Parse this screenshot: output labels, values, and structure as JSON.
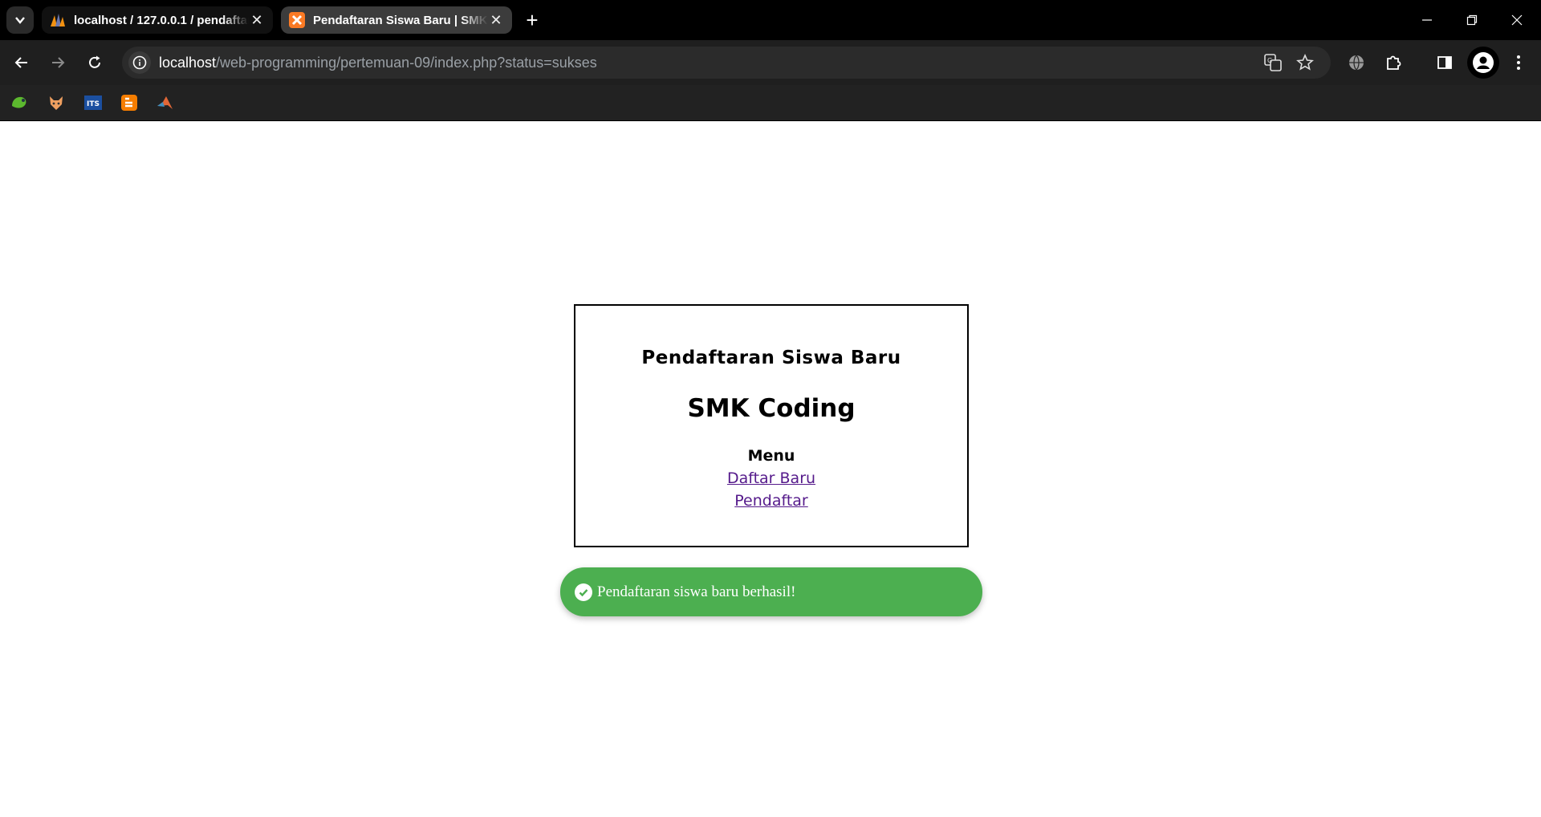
{
  "browser": {
    "tabs": [
      {
        "title": "localhost / 127.0.0.1 / pendaftaran",
        "active": false,
        "favicon": "phpmyadmin-icon"
      },
      {
        "title": "Pendaftaran Siswa Baru | SMK",
        "active": true,
        "favicon": "xampp-icon"
      }
    ],
    "url_host": "localhost",
    "url_path": "/web-programming/pertemuan-09/index.php?status=sukses",
    "bookmarks": [
      "bookmark-green-icon",
      "bookmark-fox-icon",
      "bookmark-its-icon",
      "bookmark-blogger-icon",
      "bookmark-matlab-icon"
    ],
    "its_label": "ITS"
  },
  "page": {
    "heading": "Pendaftaran Siswa Baru",
    "school": "SMK Coding",
    "menu_title": "Menu",
    "links": [
      "Daftar Baru",
      "Pendaftar"
    ],
    "toast_message": "Pendaftaran siswa baru berhasil!",
    "colors": {
      "toast_bg": "#4caf50",
      "link_visited": "#551a8b"
    }
  }
}
